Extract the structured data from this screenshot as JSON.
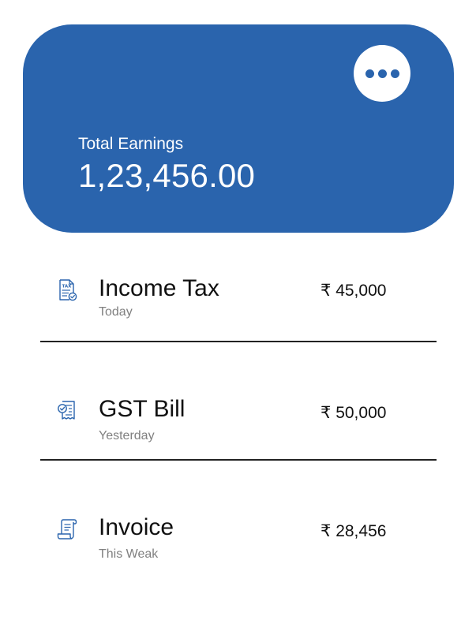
{
  "colors": {
    "card_background": "#2a64ad",
    "card_text": "#ffffff",
    "icon_color": "#2a64ad",
    "title_text": "#111111",
    "subtitle_text": "#808080",
    "divider": "#222222"
  },
  "earnings_card": {
    "label": "Total Earnings",
    "value": "1,23,456.00",
    "menu_icon": "more-horizontal-icon"
  },
  "transactions": [
    {
      "title": "Income Tax",
      "subtitle": "Today",
      "amount": "₹ 45,000",
      "icon": "tax-document-icon"
    },
    {
      "title": "GST Bill",
      "subtitle": "Yesterday",
      "amount": "₹ 50,000",
      "icon": "bill-document-icon"
    },
    {
      "title": "Invoice",
      "subtitle": "This Weak",
      "amount": "₹ 28,456",
      "icon": "invoice-scroll-icon"
    }
  ]
}
